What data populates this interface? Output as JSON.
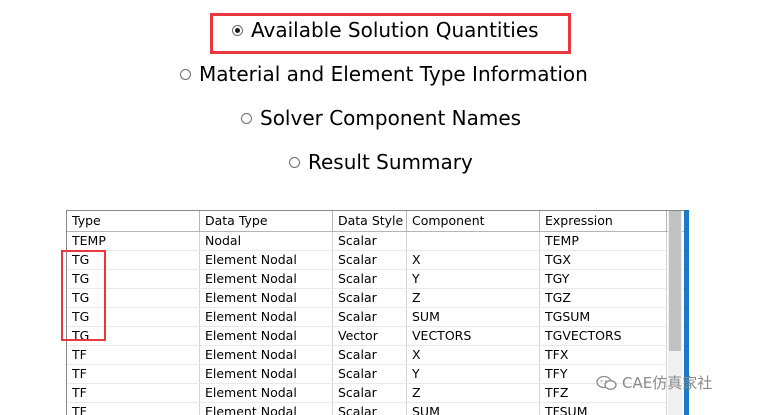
{
  "options": [
    {
      "label": "Available Solution Quantities",
      "selected": true
    },
    {
      "label": "Material and Element Type Information",
      "selected": false
    },
    {
      "label": "Solver Component Names",
      "selected": false
    },
    {
      "label": "Result Summary",
      "selected": false
    }
  ],
  "table": {
    "headers": [
      "Type",
      "Data Type",
      "Data Style",
      "Component",
      "Expression"
    ],
    "rows": [
      [
        "TEMP",
        "Nodal",
        "Scalar",
        "",
        "TEMP"
      ],
      [
        "TG",
        "Element Nodal",
        "Scalar",
        "X",
        "TGX"
      ],
      [
        "TG",
        "Element Nodal",
        "Scalar",
        "Y",
        "TGY"
      ],
      [
        "TG",
        "Element Nodal",
        "Scalar",
        "Z",
        "TGZ"
      ],
      [
        "TG",
        "Element Nodal",
        "Scalar",
        "SUM",
        "TGSUM"
      ],
      [
        "TG",
        "Element Nodal",
        "Vector",
        "VECTORS",
        "TGVECTORS"
      ],
      [
        "TF",
        "Element Nodal",
        "Scalar",
        "X",
        "TFX"
      ],
      [
        "TF",
        "Element Nodal",
        "Scalar",
        "Y",
        "TFY"
      ],
      [
        "TF",
        "Element Nodal",
        "Scalar",
        "Z",
        "TFZ"
      ],
      [
        "TF",
        "Element Nodal",
        "Scalar",
        "SUM",
        "TFSUM"
      ]
    ]
  },
  "watermark": {
    "text": "CAE仿真家社",
    "icon": "wechat-icon"
  },
  "colors": {
    "highlight": "#e8383d",
    "accent_bar": "#1979ca"
  }
}
